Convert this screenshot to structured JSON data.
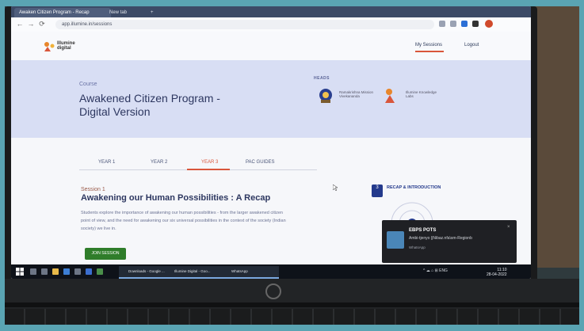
{
  "browser": {
    "tabs": [
      {
        "label": "Awaken Citizen Program - Recap"
      },
      {
        "label": "New tab"
      }
    ],
    "new_tab_label": "+",
    "url": "app.illumine.in/sessions",
    "nav": {
      "back": "←",
      "forward": "→",
      "reload": "⟳"
    }
  },
  "site": {
    "brand": "Illumine digital",
    "nav": {
      "my_sessions": "My Sessions",
      "logout": "Logout"
    }
  },
  "hero": {
    "course_label": "Course",
    "course_title": "Awakened Citizen Program - Digital Version",
    "heads_label": "HEADS",
    "heads": [
      {
        "name": "Ramakrishna Mission Vivekananda"
      },
      {
        "name": "Illumine Knowledge Labs"
      }
    ]
  },
  "tabs": [
    {
      "label": "YEAR 1"
    },
    {
      "label": "YEAR 2"
    },
    {
      "label": "YEAR 3"
    },
    {
      "label": "PAC GUIDES"
    }
  ],
  "session": {
    "label": "Session 1",
    "title": "Awakening our Human Possibilities : A Recap",
    "description": "Students explore the importance of awakening our human possibilities - from the larger awakened citizen point of view, and the need for awakening our six universal possibilities in the context of the society (Indian society) we live in.",
    "join_button": "JOIN SESSION"
  },
  "recap": {
    "badge": "3",
    "title": "RECAP & INTRODUCTION"
  },
  "notification": {
    "title": "EBPS POTS",
    "body": "Ambi-tjenyo ||Nibaz.nfa\\sm-Regionb",
    "app": "WhatsApp",
    "close": "×"
  },
  "taskbar": {
    "tasks": [
      {
        "label": "Downloads - Google ..."
      },
      {
        "label": "Illumine Digital - Goo..."
      },
      {
        "label": "WhatsApp"
      }
    ],
    "tray": "^ ☁ ⌂ ⊞ ENG",
    "time": "11:10",
    "date": "28-04-2022"
  },
  "colors": {
    "accent": "#d9563b",
    "hero_bg": "#d8def4",
    "title": "#2d3760",
    "join_button": "#2f7d2a"
  }
}
